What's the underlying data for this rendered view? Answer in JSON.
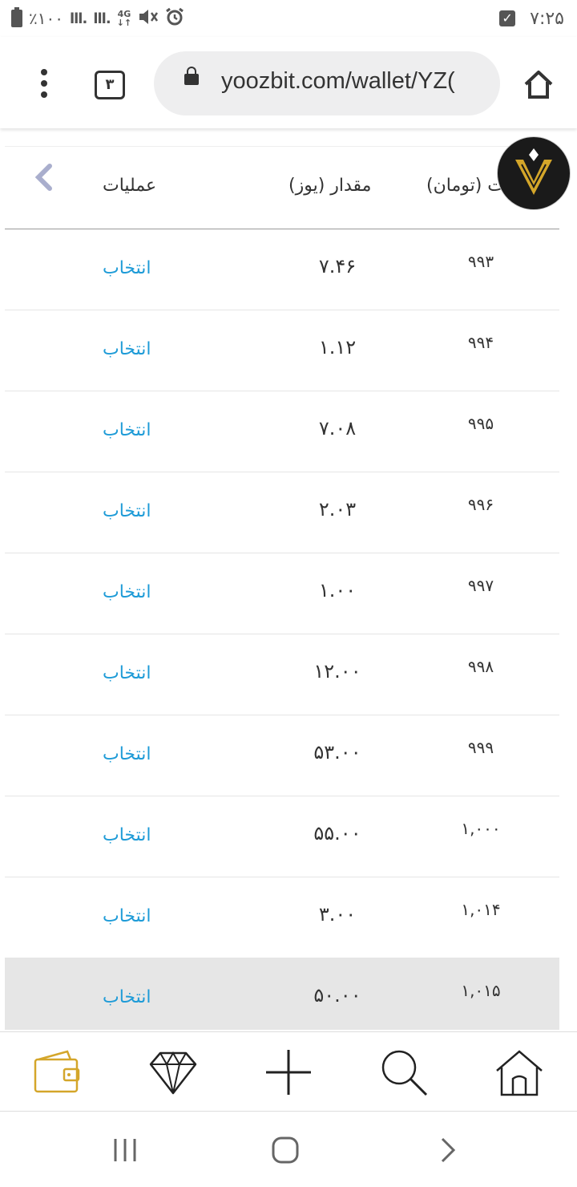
{
  "status_bar": {
    "battery_text": "٪۱۰۰",
    "signal1": "lll.",
    "signal2": "lll.",
    "network": "4G",
    "time": "۷:۲۵"
  },
  "browser": {
    "tab_count": "۳",
    "url": "yoozbit.com/wallet/YZ("
  },
  "table": {
    "headers": {
      "operations": "عملیات",
      "amount": "مقدار (یوز)",
      "price": "ت (تومان)"
    },
    "rows": [
      {
        "price": "۹۹۳",
        "amount": "۷.۴۶",
        "action": "انتخاب"
      },
      {
        "price": "۹۹۴",
        "amount": "۱.۱۲",
        "action": "انتخاب"
      },
      {
        "price": "۹۹۵",
        "amount": "۷.۰۸",
        "action": "انتخاب"
      },
      {
        "price": "۹۹۶",
        "amount": "۲.۰۳",
        "action": "انتخاب"
      },
      {
        "price": "۹۹۷",
        "amount": "۱.۰۰",
        "action": "انتخاب"
      },
      {
        "price": "۹۹۸",
        "amount": "۱۲.۰۰",
        "action": "انتخاب"
      },
      {
        "price": "۹۹۹",
        "amount": "۵۳.۰۰",
        "action": "انتخاب"
      },
      {
        "price": "۱,۰۰۰",
        "amount": "۵۵.۰۰",
        "action": "انتخاب"
      },
      {
        "price": "۱,۰۱۴",
        "amount": "۳.۰۰",
        "action": "انتخاب"
      },
      {
        "price": "۱,۰۱۵",
        "amount": "۵۰.۰۰",
        "action": "انتخاب"
      }
    ]
  },
  "colors": {
    "link": "#1e9bd7",
    "wallet_active": "#d4a62a",
    "highlight_row": "#e6e6e6"
  },
  "bottom_nav": [
    "wallet-icon",
    "diamond-icon",
    "plus-icon",
    "search-icon",
    "home-icon"
  ],
  "system_nav": [
    "recents-icon",
    "home-circle-icon",
    "back-icon"
  ]
}
